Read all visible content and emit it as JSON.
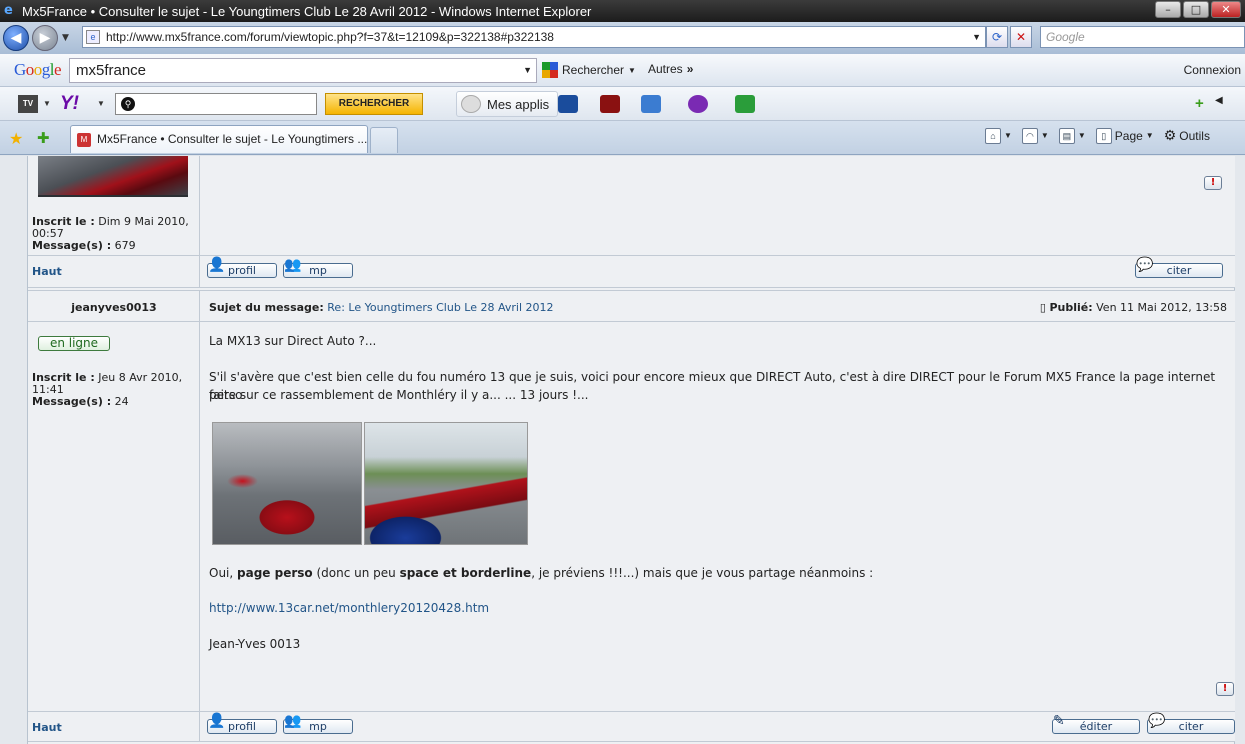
{
  "window": {
    "title": "Mx5France • Consulter le sujet - Le Youngtimers Club Le 28 Avril 2012 - Windows Internet Explorer",
    "minimize": "–",
    "maximize": "□",
    "close": "✕"
  },
  "address_bar": {
    "url": "http://www.mx5france.com/forum/viewtopic.php?f=37&t=12109&p=322138#p322138",
    "search_placeholder": "Google"
  },
  "google_toolbar": {
    "logo": "Google",
    "search_value": "mx5france",
    "search_button": "Rechercher",
    "more_button": "Autres",
    "signin": "Connexion"
  },
  "yahoo_toolbar": {
    "logo": "Y!",
    "search_button": "RECHERCHER",
    "apps_label": "Mes applis"
  },
  "tabs": [
    {
      "label": "Mx5France • Consulter le sujet - Le Youngtimers ..."
    }
  ],
  "command_bar": {
    "page_label": "Page",
    "tools_label": "Outils"
  },
  "previous_post": {
    "registered_label": "Inscrit le :",
    "registered_value": "Dim 9 Mai 2010,",
    "registered_time": "00:57",
    "messages_label": "Message(s) :",
    "messages_value": "679",
    "top_link": "Haut",
    "profile_button": "profil",
    "pm_button": "mp",
    "quote_button": "citer"
  },
  "post": {
    "author": "jeanyves0013",
    "subject_label": "Sujet du message:",
    "subject_value": "Re: Le Youngtimers Club Le 28 Avril 2012",
    "posted_label": "Publié:",
    "posted_value": "Ven 11 Mai 2012, 13:58",
    "online_badge": "en ligne",
    "registered_label": "Inscrit le :",
    "registered_value": "Jeu 8 Avr 2010,",
    "registered_time": "11:41",
    "messages_label": "Message(s) :",
    "messages_value": "24",
    "line1": "La MX13 sur Direct Auto ?...",
    "line2a": "S'il s'avère que c'est bien celle du fou numéro 13 que je suis, voici pour encore mieux que DIRECT Auto, c'est à dire DIRECT pour le Forum MX5 France la page internet perso",
    "line2b": "faite sur ce rassemblement de Monthléry il y a... ... 13 jours !...",
    "line3_pre": "Oui, ",
    "line3_bold1": "page perso",
    "line3_mid": " (donc un peu ",
    "line3_bold2": "space et borderline",
    "line3_post": ", je préviens !!!...) mais que je vous partage néanmoins :",
    "link": "http://www.13car.net/monthlery20120428.htm",
    "signature": "Jean-Yves 0013",
    "top_link": "Haut",
    "profile_button": "profil",
    "pm_button": "mp",
    "edit_button": "éditer",
    "quote_button": "citer"
  },
  "icons": {
    "report": "!"
  }
}
